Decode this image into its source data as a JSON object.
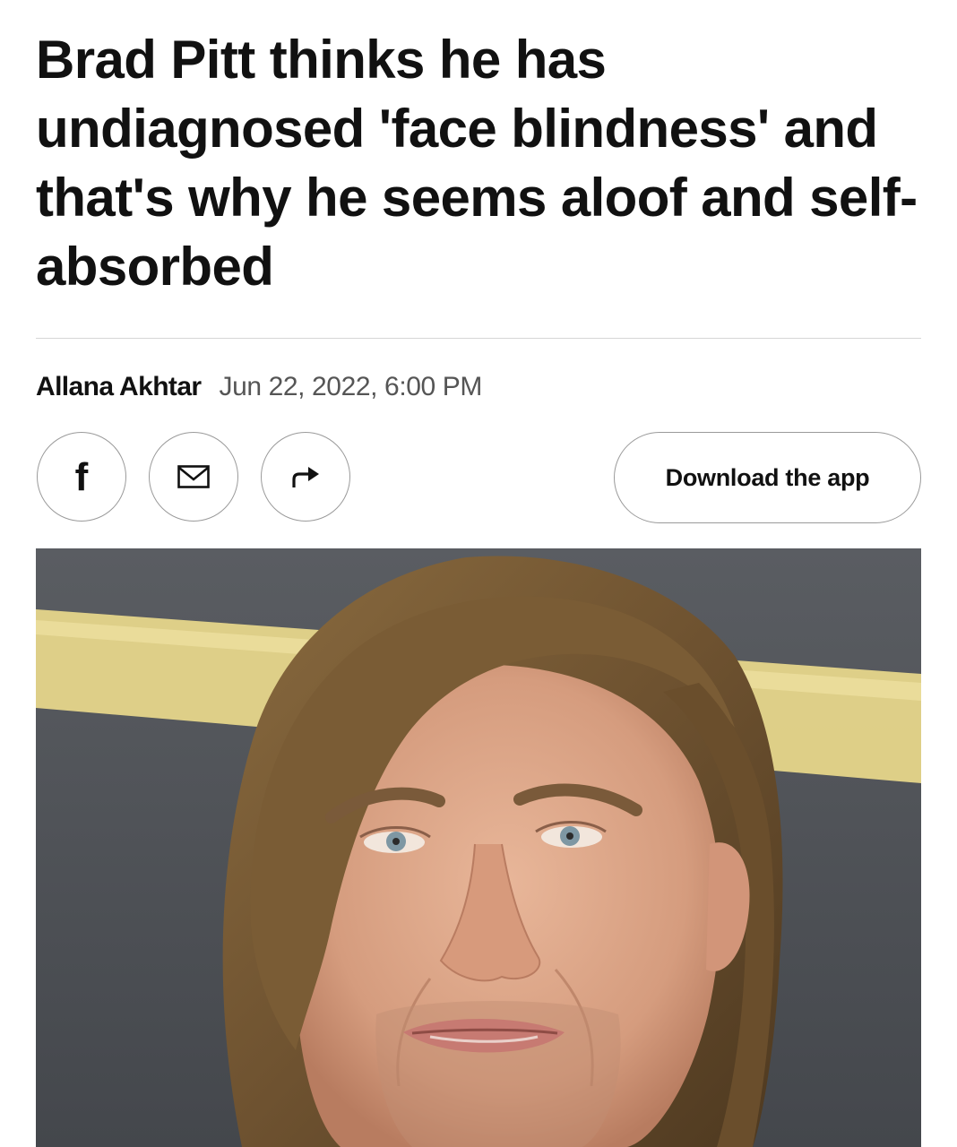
{
  "article": {
    "headline": "Brad Pitt thinks he has undiagnosed 'face blindness' and that's why he seems aloof and self-absorbed",
    "author": "Allana Akhtar",
    "timestamp": "Jun 22, 2022, 6:00 PM"
  },
  "share": {
    "facebook_glyph": "f",
    "facebook_icon": "facebook-icon",
    "email_icon": "email-icon",
    "forward_icon": "share-forward-icon"
  },
  "cta": {
    "download_label": "Download the app"
  },
  "colors": {
    "text": "#111111",
    "muted_text": "#555555",
    "divider": "#d6d6d6",
    "button_border": "#9a9a9a",
    "photo_backdrop": "#4e5156",
    "backdrop_stripe": "#e9d98c"
  }
}
